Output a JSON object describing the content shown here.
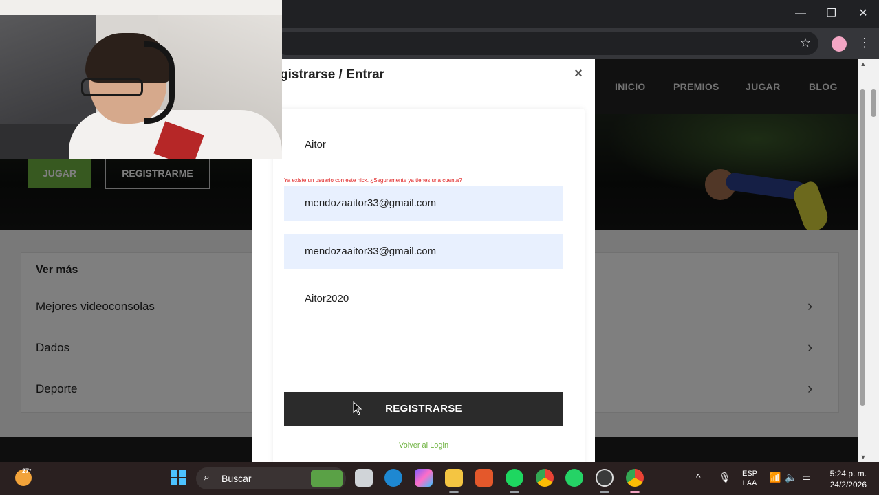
{
  "browser": {
    "window_controls": {
      "minimize": "—",
      "restore": "❐",
      "close": "✕"
    },
    "icons": [
      "star-icon",
      "profile-icon",
      "menu-icon"
    ]
  },
  "site": {
    "nav": [
      "INICIO",
      "PREMIOS",
      "JUGAR",
      "BLOG"
    ],
    "hero_buttons": {
      "play": "JUGAR",
      "register": "REGISTRARME"
    },
    "more": {
      "title": "Ver más",
      "items": [
        "Mejores videoconsolas",
        "Dados",
        "Deporte"
      ]
    }
  },
  "modal": {
    "title": "gistrarse / Entrar",
    "close_icon": "×",
    "fields": {
      "nick": "Aitor",
      "email": "mendozaaitor33@gmail.com",
      "email_confirm": "mendozaaitor33@gmail.com",
      "password": "Aitor2020"
    },
    "error": "Ya existe un usuario con este nick. ¿Seguramente ya tienes una cuenta?",
    "submit": "REGISTRARSE",
    "login_link": "Volver al Login"
  },
  "taskbar": {
    "weather": "27°",
    "search_label": "Buscar",
    "lang": [
      "ESP",
      "LAA"
    ],
    "time": "5:24 p. m.",
    "date": "24/2/2026",
    "colors": {
      "start": "#4cc2ff",
      "accent_green": "#6fb341"
    }
  }
}
